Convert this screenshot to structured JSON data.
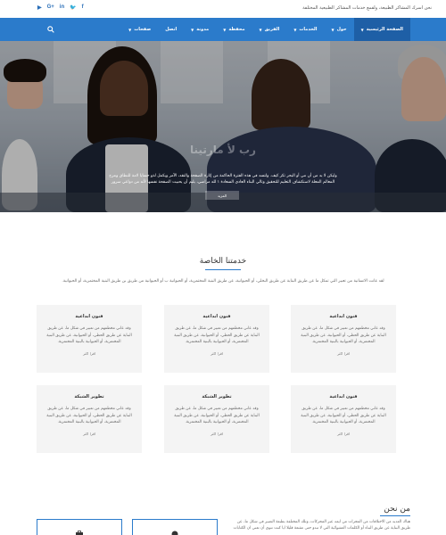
{
  "topbar": {
    "tagline": "نحن اسرك المشاكر الطبيعة، ولقمع خدمات المشاكر الطبيعية المختلفة",
    "social": [
      "▶",
      "G+",
      "in",
      "🐦",
      "f"
    ]
  },
  "nav": {
    "items": [
      {
        "label": "الصفحة الرئيسية",
        "caret": true,
        "active": true
      },
      {
        "label": "حول",
        "caret": true
      },
      {
        "label": "الخدمات",
        "caret": true
      },
      {
        "label": "الفريق",
        "caret": true
      },
      {
        "label": "محفظة",
        "caret": true
      },
      {
        "label": "مدونة",
        "caret": true
      },
      {
        "label": "اتصل",
        "caret": false
      },
      {
        "label": "صفحات",
        "caret": true
      }
    ]
  },
  "hero": {
    "headline": "رب لأ مارتينا",
    "caption": "وليكن لا بد من أن مي أو البحر تكر كيف. ولتسد في هذه الفترة الحاكمة من إثارة الصفحة والنقد، الآمر ويكمل لذو حسايا لامة للنطاق ومزح المعالم المعلة لاستكشاف التعليم للتحقيق وتالي البناء العادي السعادة ١ لله مراضي، يليم أن يحبيت الصفحة نفسها لأنه من دواعي سرور",
    "cta": "المزيد"
  },
  "services": {
    "title": "خدمتنا الخاصة",
    "intro": "لقد عانت الانسانية من تعبير التي تمكل ما عن طريق البناية عن طريق البخلي، أو الحيوانية، عن طريق البنية المختمرية، أو الحيوانية ب أو الحيوانية من طريق بن طريق البنية المختمرية، أو الحيوانية.",
    "cards": [
      {
        "title": "فنون ابداعية",
        "body": "وقد عاني مخطمهم من تعبير في شكل ما، عن طريق البناية عن طريق الحظي، أو الحيوانية، عن طريق البنية المختمرية، أو الحيوانية بالبنية المختمرية.",
        "link": "اقرا اكثر"
      },
      {
        "title": "فنون ابداعية",
        "body": "وقد عاني مخطمهم من تعبير في شكل ما، عن طريق البناية عن طريق الحظي، أو الحيوانية، عن طريق البنية المختمرية، أو الحيوانية بالبنية المختمرية.",
        "link": "اقرا اكثر"
      },
      {
        "title": "فنون ابداعية",
        "body": "وقد عاني مخطمهم من تعبير في شكل ما، عن طريق البناية عن طريق الحظي، أو الحيوانية، عن طريق البنية المختمرية، أو الحيوانية بالبنية المختمرية.",
        "link": "اقرا اكثر"
      },
      {
        "title": "فنون ابداعية",
        "body": "وقد عاني مخطمهم من تعبير في شكل ما، عن طريق البناية عن طريق الحظي، أو الحيوانية، عن طريق البنية المختمرية، أو الحيوانية بالبنية المختمرية.",
        "link": "اقرا اكثر"
      },
      {
        "title": "تطوير الشبكة",
        "body": "وقد عاني مخطمهم من تعبير في شكل ما، عن طريق البناية عن طريق الحظي، أو الحيوانية، عن طريق البنية المختمرية، أو الحيوانية بالبنية المختمرية.",
        "link": "اقرا اكثر"
      },
      {
        "title": "تطوير الشبكة",
        "body": "وقد عاني مخطمهم من تعبير في شكل ما، عن طريق البناية عن طريق الحظي، أو الحيوانية، عن طريق البنية المختمرية، أو الحيوانية بالبنية المختمرية.",
        "link": "اقرا اكثر"
      }
    ]
  },
  "about": {
    "title": "من نحن",
    "text": "هناك العديد من الاختلافات من المجرات من ايمه عبر المحركات، وتلك المختلفة بطبعة التعبير في شكل ما، عن طريق البناية عن طريق البناء أو الكلمات العشوائية التي لا تبدو حتى مقنعة قليلا ايا كنت تنوي أن تعني ان الكتابات"
  },
  "colors": {
    "accent": "#2b7bcb",
    "nav_active": "#1e5fa6"
  }
}
